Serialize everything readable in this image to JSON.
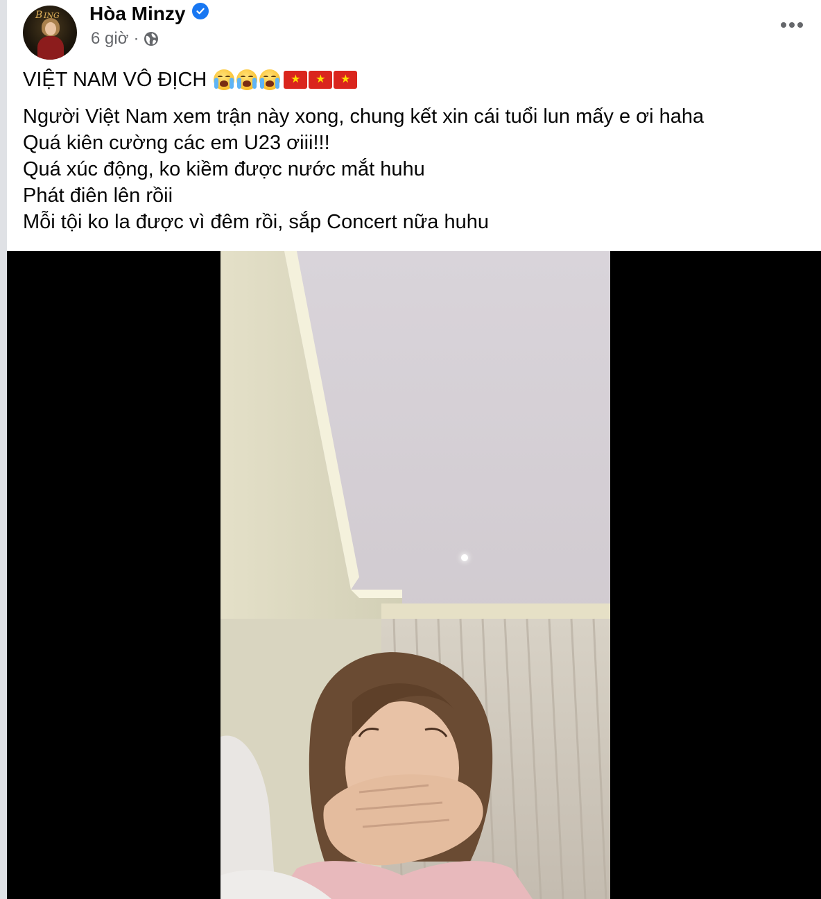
{
  "post": {
    "author": "Hòa Minzy",
    "verified": true,
    "time": "6 giờ",
    "separator": "·",
    "privacy_icon": "globe-icon",
    "menu_icon": "more-options-icon",
    "headline": "VIỆT NAM VÔ ĐỊCH",
    "headline_emojis": [
      "loudly-crying-face",
      "loudly-crying-face",
      "loudly-crying-face",
      "vietnam-flag",
      "vietnam-flag",
      "vietnam-flag"
    ],
    "lines": [
      "Người Việt Nam xem trận này xong, chung kết xin cái tuổi lun mấy e ơi haha",
      "Quá kiên cường các em U23 ơiii!!!",
      "Quá xúc động, ko kiềm được nước mắt huhu",
      "Phát điên lên rồii",
      "Mỗi tội ko la được vì đêm rồi, sắp Concert nữa huhu"
    ]
  },
  "colors": {
    "verified_blue": "#1877f2",
    "text_primary": "#050505",
    "text_secondary": "#65676b",
    "video_bg": "#000000"
  }
}
